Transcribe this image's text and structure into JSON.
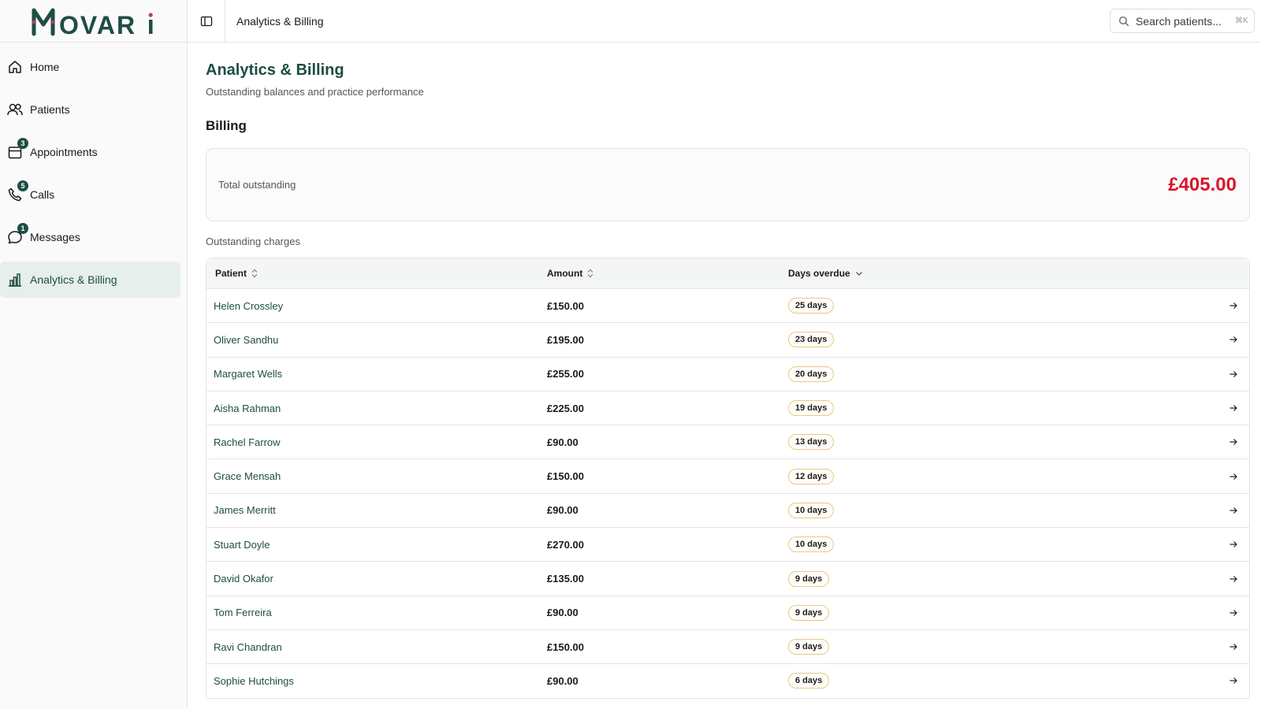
{
  "brand": {
    "name": "MOVARi",
    "color": "#1f4d44",
    "accent": "#c0357a"
  },
  "sidebar": {
    "items": [
      {
        "label": "Home",
        "icon": "home-icon",
        "badge": null,
        "active": false
      },
      {
        "label": "Patients",
        "icon": "users-icon",
        "badge": null,
        "active": false
      },
      {
        "label": "Appointments",
        "icon": "calendar-icon",
        "badge": "3",
        "active": false
      },
      {
        "label": "Calls",
        "icon": "phone-icon",
        "badge": "5",
        "active": false
      },
      {
        "label": "Messages",
        "icon": "message-icon",
        "badge": "1",
        "active": false
      },
      {
        "label": "Analytics & Billing",
        "icon": "bar-chart-icon",
        "badge": null,
        "active": true
      }
    ]
  },
  "topbar": {
    "title": "Analytics & Billing",
    "search_placeholder": "Search patients...",
    "search_shortcut": "⌘K"
  },
  "page": {
    "title": "Analytics & Billing",
    "subtitle": "Outstanding balances and practice performance",
    "section": "Billing"
  },
  "summary": {
    "label": "Total outstanding",
    "value": "£405.00",
    "value_color": "#d9142b"
  },
  "table": {
    "caption": "Outstanding charges",
    "headers": {
      "patient": "Patient",
      "amount": "Amount",
      "days": "Days overdue"
    },
    "rows": [
      {
        "patient": "Helen Crossley",
        "amount": "£150.00",
        "days": "25 days"
      },
      {
        "patient": "Oliver Sandhu",
        "amount": "£195.00",
        "days": "23 days"
      },
      {
        "patient": "Margaret Wells",
        "amount": "£255.00",
        "days": "20 days"
      },
      {
        "patient": "Aisha Rahman",
        "amount": "£225.00",
        "days": "19 days"
      },
      {
        "patient": "Rachel Farrow",
        "amount": "£90.00",
        "days": "13 days"
      },
      {
        "patient": "Grace Mensah",
        "amount": "£150.00",
        "days": "12 days"
      },
      {
        "patient": "James Merritt",
        "amount": "£90.00",
        "days": "10 days"
      },
      {
        "patient": "Stuart Doyle",
        "amount": "£270.00",
        "days": "10 days"
      },
      {
        "patient": "David Okafor",
        "amount": "£135.00",
        "days": "9 days"
      },
      {
        "patient": "Tom Ferreira",
        "amount": "£90.00",
        "days": "9 days"
      },
      {
        "patient": "Ravi Chandran",
        "amount": "£150.00",
        "days": "9 days"
      },
      {
        "patient": "Sophie Hutchings",
        "amount": "£90.00",
        "days": "6 days"
      }
    ]
  }
}
